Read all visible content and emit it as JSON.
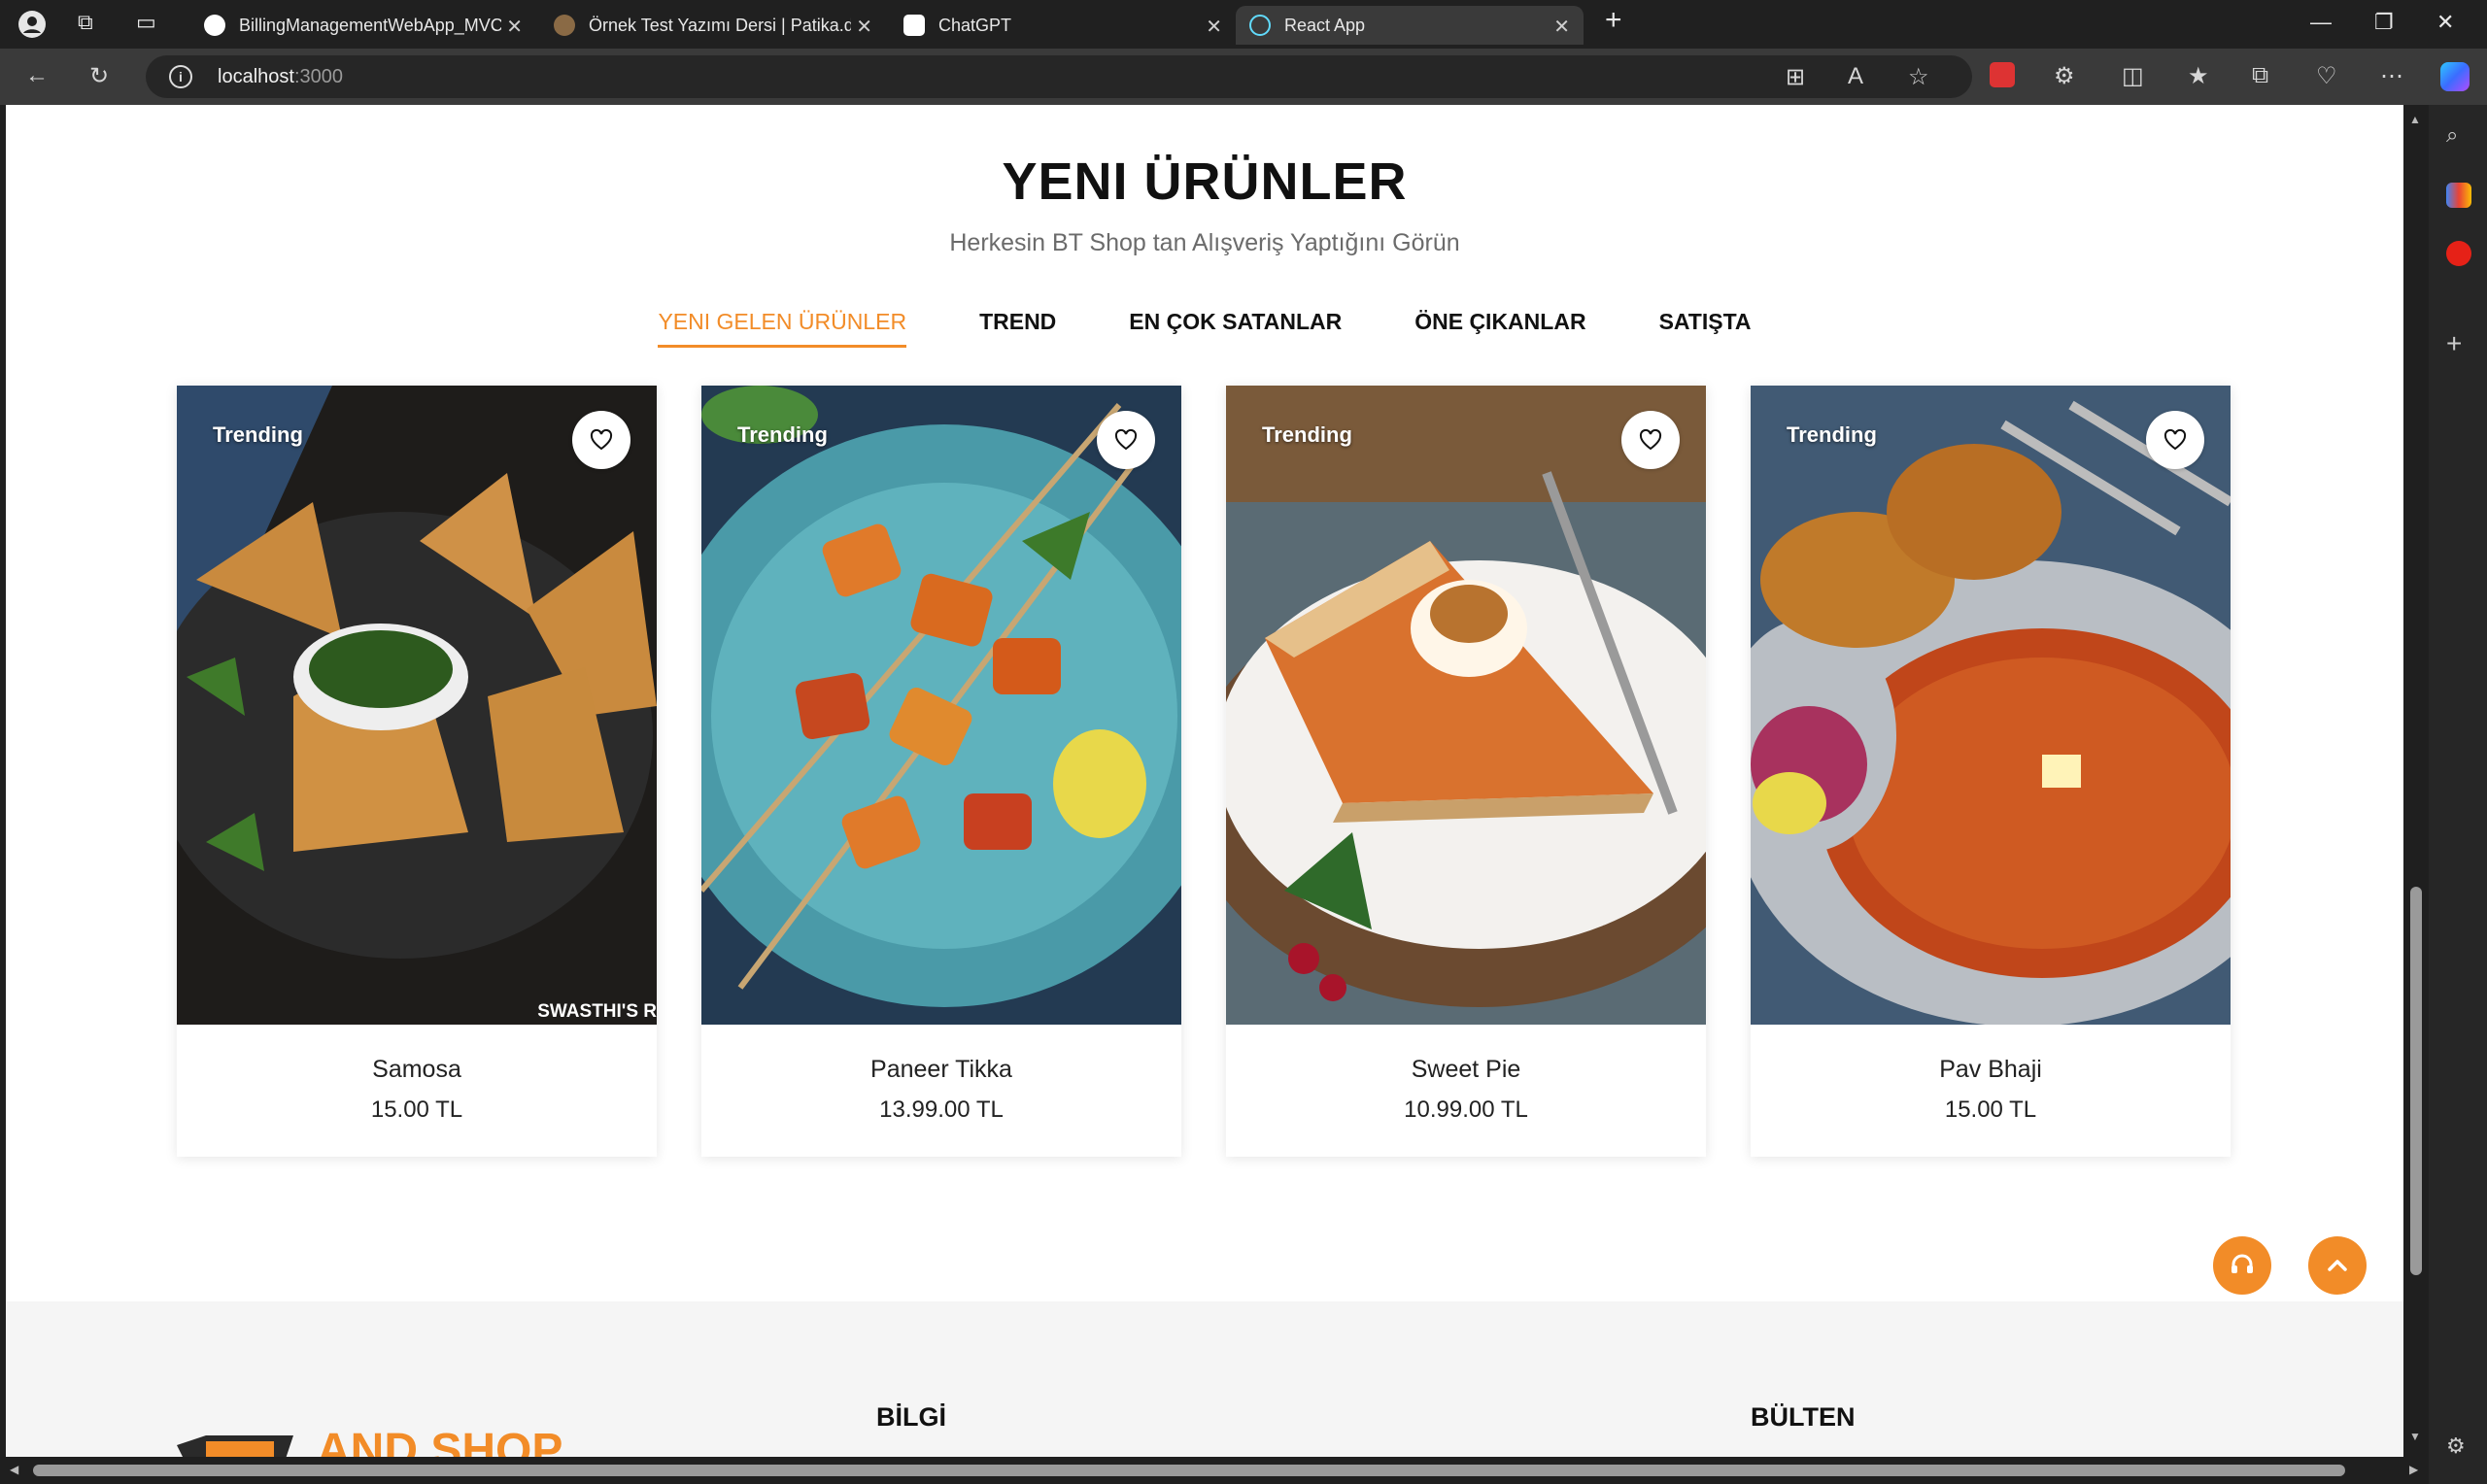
{
  "browser": {
    "tabs": [
      {
        "label": "BillingManagementWebApp_MVC"
      },
      {
        "label": "Örnek Test Yazımı Dersi | Patika.dev"
      },
      {
        "label": "ChatGPT"
      },
      {
        "label": "React App"
      }
    ],
    "url_host": "localhost",
    "url_port": ":3000"
  },
  "page": {
    "title": "YENI ÜRÜNLER",
    "subtitle": "Herkesin BT Shop tan Alışveriş Yaptığını Görün",
    "tabs": [
      {
        "label": "YENI GELEN ÜRÜNLER",
        "active": true
      },
      {
        "label": "TREND"
      },
      {
        "label": "EN ÇOK SATANLAR"
      },
      {
        "label": "ÖNE ÇIKANLAR"
      },
      {
        "label": "SATIŞTA"
      }
    ],
    "products": [
      {
        "badge": "Trending",
        "name": "Samosa",
        "price": "15.00 TL",
        "watermark": "SWASTHI'S R"
      },
      {
        "badge": "Trending",
        "name": "Paneer Tikka",
        "price": "13.99.00 TL"
      },
      {
        "badge": "Trending",
        "name": "Sweet Pie",
        "price": "10.99.00 TL"
      },
      {
        "badge": "Trending",
        "name": "Pav Bhaji",
        "price": "15.00 TL"
      }
    ]
  },
  "footer": {
    "logo_text": "AND SHOP",
    "info_heading": "BİLGİ",
    "newsletter_heading": "BÜLTEN"
  },
  "colors": {
    "accent": "#f28c28"
  }
}
